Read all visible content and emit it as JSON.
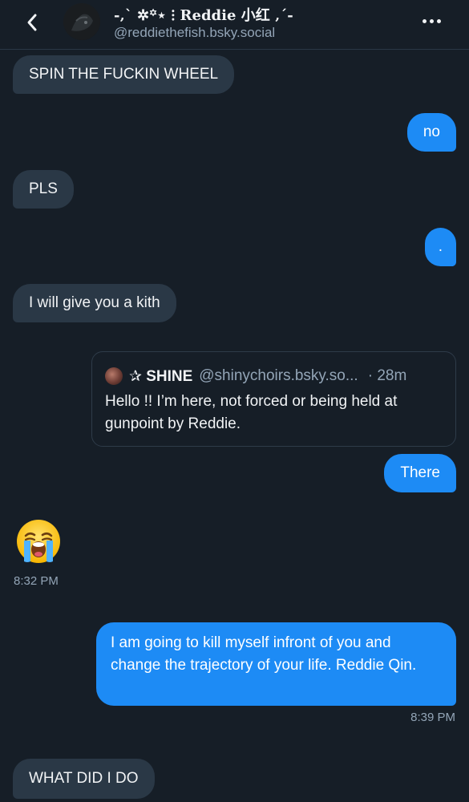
{
  "header": {
    "display_name": "-‚ˋ ✲꙳⋆ ⁝ Reddie 小红 ‚ˊ-",
    "handle": "@reddiethefish.bsky.social"
  },
  "messages": [
    {
      "text": "SPIN THE FUCKIN WHEEL"
    },
    {
      "text": "no"
    },
    {
      "text": "PLS"
    },
    {
      "text": "."
    },
    {
      "text": "I will give you a kith"
    },
    {
      "text": "There"
    },
    {
      "text": "I am going to kill myself infront of you and change the trajectory of your life. Reddie Qin."
    },
    {
      "text": "WHAT DID I DO"
    }
  ],
  "quoted_post": {
    "name": "✰ SHINE",
    "handle": "@shinychoirs.bsky.so...",
    "ago": "· 28m",
    "text": "Hello !! I’m here, not forced or being held at gunpoint by Reddie."
  },
  "timestamps": {
    "t1": "8:32 PM",
    "t2": "8:39 PM"
  },
  "icons": {
    "back": "chevron-left-icon",
    "more": "more-horizontal-icon",
    "emoji": "loudly-crying-face"
  },
  "colors": {
    "background": "#161e27",
    "incoming_bubble": "#2a3846",
    "outgoing_bubble": "#1d8bf5"
  }
}
